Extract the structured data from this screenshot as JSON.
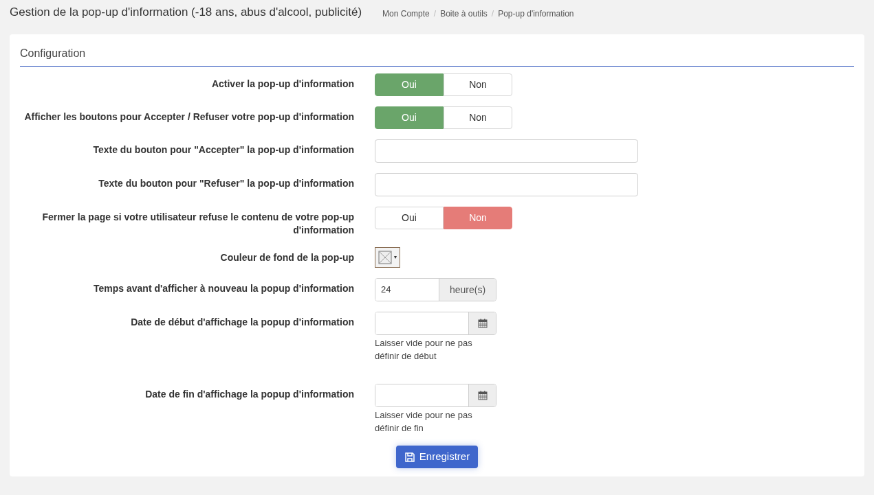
{
  "page_title": "Gestion de la pop-up d'information (-18 ans, abus d'alcool, publicité)",
  "breadcrumb": {
    "separator": "/",
    "items": [
      "Mon Compte",
      "Boite à outils",
      "Pop-up d'information"
    ]
  },
  "panel": {
    "title": "Configuration",
    "rows": [
      {
        "kind": "toggle",
        "label": "Activer la pop-up d'information",
        "options": [
          {
            "label": "Oui",
            "color": "#6aa56a",
            "selected": true
          },
          {
            "label": "Non",
            "selected": false
          }
        ]
      },
      {
        "kind": "toggle",
        "label": "Afficher les boutons pour Accepter / Refuser votre pop-up d'information",
        "options": [
          {
            "label": "Oui",
            "color": "#6aa56a",
            "selected": true
          },
          {
            "label": "Non",
            "selected": false
          }
        ]
      },
      {
        "kind": "text",
        "label": "Texte du bouton pour \"Accepter\" la pop-up d'information"
      },
      {
        "kind": "text",
        "label": "Texte du bouton pour \"Refuser\" la pop-up d'information"
      },
      {
        "kind": "toggle",
        "label": "Fermer la page si votre utilisateur refuse le contenu de votre pop-up d'information",
        "options": [
          {
            "label": "Oui",
            "selected": false
          },
          {
            "label": "Non",
            "color": "#e57c78",
            "selected": true
          }
        ]
      },
      {
        "kind": "color",
        "label": "Couleur de fond de la pop-up",
        "caret": "▾"
      },
      {
        "kind": "number_unit",
        "label": "Temps avant d'afficher à nouveau la popup d'information",
        "value": "24",
        "unit": "heure(s)"
      },
      {
        "kind": "date",
        "label": "Date de début d'affichage la popup d'information",
        "help": "Laisser vide pour ne pas définir de début"
      },
      {
        "kind": "date",
        "label": "Date de fin d'affichage la popup d'information",
        "help": "Laisser vide pour ne pas définir de fin"
      }
    ],
    "save_button": "Enregistrer"
  }
}
